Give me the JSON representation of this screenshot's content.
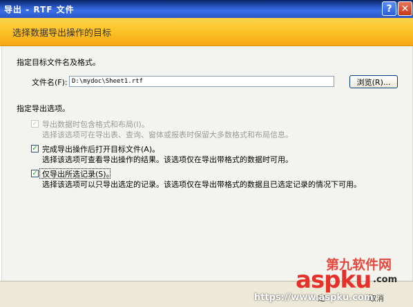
{
  "window": {
    "title": "导出 - RTF 文件",
    "help_glyph": "?",
    "close_glyph": "✕"
  },
  "header": {
    "heading": "选择数据导出操作的目标"
  },
  "destination": {
    "instruction": "指定目标文件名及格式。",
    "file_label": "文件名(F):",
    "file_value": "D:\\mydoc\\Sheet1.rtf",
    "browse_label": "浏览(R)..."
  },
  "options": {
    "title": "指定导出选项。",
    "items": [
      {
        "label": "导出数据时包含格式和布局(I)。",
        "desc": "选择该选项可在导出表、查询、窗体或报表时保留大多数格式和布局信息。",
        "checked": true,
        "enabled": false,
        "check": "✓"
      },
      {
        "label": "完成导出操作后打开目标文件(A)。",
        "desc": "选择该选项可查看导出操作的结果。该选项仅在导出带格式的数据时可用。",
        "checked": true,
        "enabled": true,
        "check": "✓"
      },
      {
        "label": "仅导出所选记录(S)。",
        "desc": "选择该选项可以只导出选定的记录。该选项仅在导出带格式的数据且已选定记录的情况下可用。",
        "checked": true,
        "enabled": true,
        "check": "✓"
      }
    ]
  },
  "watermark": {
    "line1": "第九软件网",
    "line2": "aspku",
    "line3": ".com",
    "url": "https://www.aspku.com",
    "footer_partial": "定",
    "footer_partial2": "取消"
  },
  "colors": {
    "title_bar": "#2f5fd0",
    "header_band": "#fbbf24",
    "panel": "#f3f3ef"
  }
}
